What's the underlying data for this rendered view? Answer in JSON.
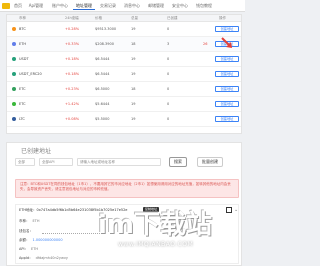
{
  "nav": {
    "items": [
      {
        "label": "首页"
      },
      {
        "label": "Api管理"
      },
      {
        "label": "账户中心"
      },
      {
        "label": "地址管理"
      },
      {
        "label": "交易记录"
      },
      {
        "label": "消息中心"
      },
      {
        "label": "邮储管理"
      },
      {
        "label": "安全中心"
      },
      {
        "label": "钱包教程"
      }
    ]
  },
  "table": {
    "headers": [
      "币种",
      "24h涨幅",
      "价格",
      "总量",
      "已创建",
      "",
      "操作"
    ],
    "rows": [
      {
        "name": "BTC",
        "change": "+0.28%",
        "price": "$9513.3000",
        "volume": "19",
        "created": "0",
        "badge": "",
        "action": "创建地址",
        "icon_color": "#f7931a"
      },
      {
        "name": "ETH",
        "change": "+0.33%",
        "price": "$208.3900",
        "volume": "18",
        "created": "3",
        "badge": "26",
        "action": "创建地址",
        "icon_color": "#627eea"
      },
      {
        "name": "USDT",
        "change": "+0.18%",
        "price": "$6.5444",
        "volume": "19",
        "created": "0",
        "badge": "",
        "action": "创建地址",
        "icon_color": "#26a17b"
      },
      {
        "name": "USDT_ERC20",
        "change": "+0.18%",
        "price": "$6.5444",
        "volume": "19",
        "created": "0",
        "badge": "",
        "action": "创建地址",
        "icon_color": "#26a17b"
      },
      {
        "name": "ETC",
        "change": "+0.23%",
        "price": "$6.5000",
        "volume": "18",
        "created": "0",
        "badge": "",
        "action": "创建地址",
        "icon_color": "#33a05d"
      },
      {
        "name": "ETC",
        "change": "+1.42%",
        "price": "$5.6444",
        "volume": "19",
        "created": "0",
        "badge": "",
        "action": "创建地址",
        "icon_color": "#3ab83a"
      },
      {
        "name": "LTC",
        "change": "+0.08%",
        "price": "$5.5000",
        "volume": "19",
        "created": "0",
        "badge": "",
        "action": "创建地址",
        "icon_color": "#345d9d"
      }
    ]
  },
  "created": {
    "title": "已创建地址",
    "coin_select": "全部",
    "type_select": "全部API",
    "search_placeholder": "请输入地址或地址名称",
    "search_button": "搜索",
    "create_button": "批量创建"
  },
  "notice": {
    "text": "注意：BTC和USDT在同的钱包地址（1币1），不要用其它的币对应地址（2币1）如想使用请用对应的地址充值，如转其他的地址内会丢失，会导致资产丢失，请注意钱包地址与对应的币种充值。"
  },
  "card": {
    "coin": "ETH地址",
    "address": "0x747a4db5f6b1d5b64e231038f5b1b7025e17e52e",
    "tag": "复制地址",
    "fields": [
      {
        "label": "币种：",
        "value": "ETH"
      },
      {
        "label": "钱包名：",
        "value": ""
      },
      {
        "label": "余额：",
        "value": "1.000000000000"
      },
      {
        "label": "API：",
        "value": "ETH"
      },
      {
        "label": "AppId：",
        "value": "dfdajmh40n2ywvy"
      }
    ]
  },
  "watermark": {
    "text": "im下载站",
    "sub": "www.IMQIANBAO.COM"
  }
}
